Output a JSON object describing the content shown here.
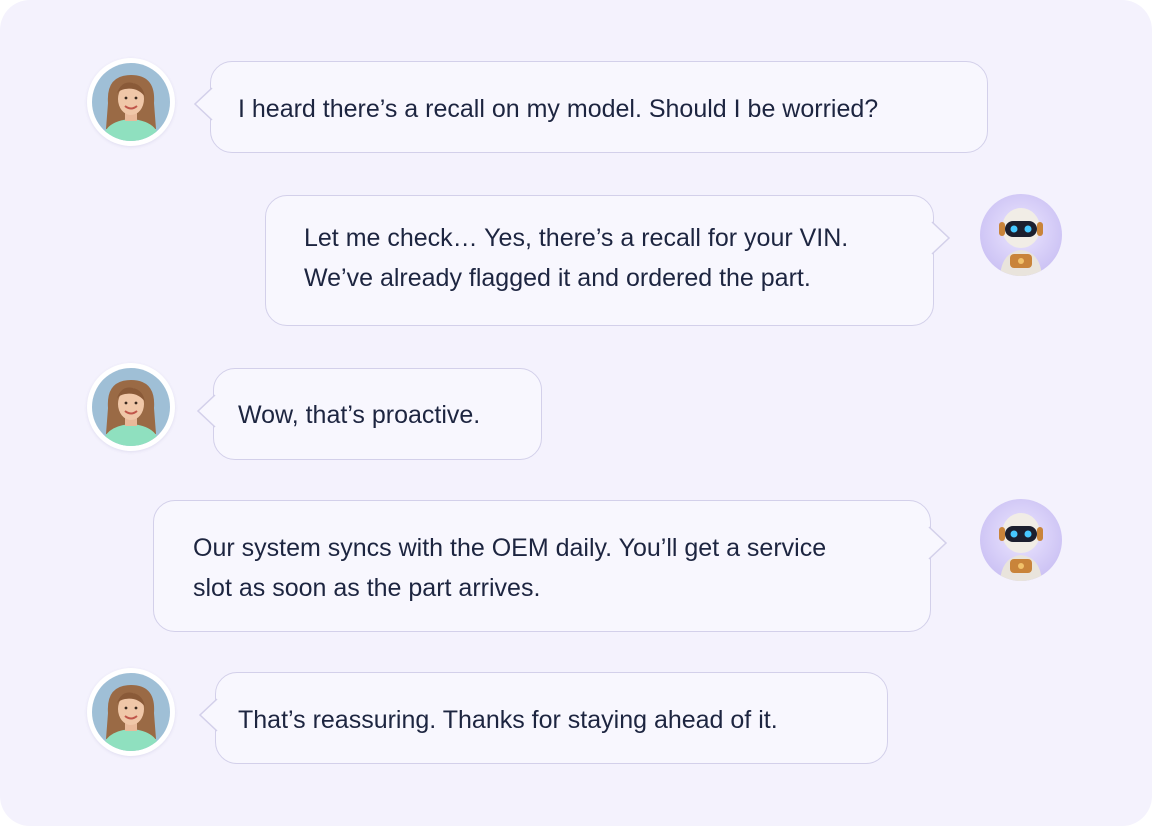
{
  "conversation": {
    "messages": [
      {
        "sender": "customer",
        "avatar_icon": "customer-avatar-icon",
        "text": [
          "I heard there’s a recall on my model. Should I be worried?"
        ]
      },
      {
        "sender": "assistant",
        "avatar_icon": "robot-avatar-icon",
        "text": [
          "Let me check… Yes, there’s a recall for your VIN.",
          "We’ve already flagged it and ordered the part."
        ]
      },
      {
        "sender": "customer",
        "avatar_icon": "customer-avatar-icon",
        "text": [
          "Wow, that’s proactive."
        ]
      },
      {
        "sender": "assistant",
        "avatar_icon": "robot-avatar-icon",
        "text": [
          "Our system syncs with the OEM daily. You’ll get a service",
          "slot as soon as the part arrives."
        ]
      },
      {
        "sender": "customer",
        "avatar_icon": "customer-avatar-icon",
        "text": [
          "That’s reassuring. Thanks for staying ahead of it."
        ]
      }
    ]
  },
  "colors": {
    "background": "#f4f2fd",
    "bubble_fill": "#f8f7fe",
    "bubble_border": "#d3d0ea",
    "text": "#1d2540"
  }
}
